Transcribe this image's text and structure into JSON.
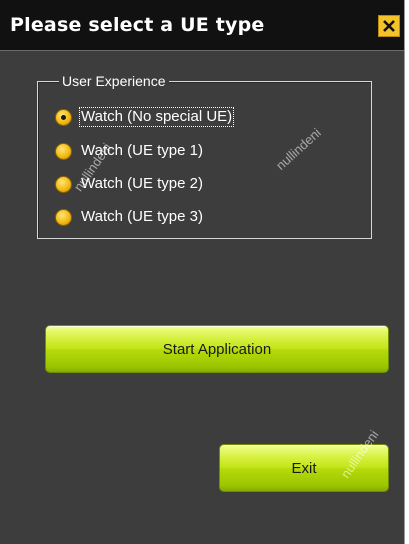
{
  "window": {
    "title": "Please select a UE type",
    "close_icon": "close-icon"
  },
  "group": {
    "legend": "User Experience",
    "options": [
      {
        "label": "Watch (No special UE)",
        "selected": true
      },
      {
        "label": "Watch (UE type 1)",
        "selected": false
      },
      {
        "label": "Watch (UE type 2)",
        "selected": false
      },
      {
        "label": "Watch (UE type 3)",
        "selected": false
      }
    ]
  },
  "buttons": {
    "start_label": "Start Application",
    "exit_label": "Exit"
  },
  "watermark": {
    "text": "nullindeni"
  },
  "colors": {
    "title_bg": "#111111",
    "window_bg": "#3d3d3d",
    "radio_yellow": "#f2bb14",
    "button_green": "#b6da0c",
    "close_yellow": "#f3c329"
  }
}
